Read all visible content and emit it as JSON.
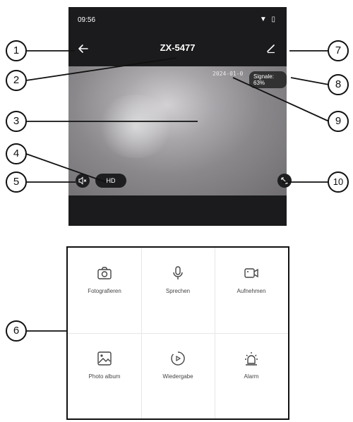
{
  "status": {
    "time": "09:56",
    "right": "▼ ▯"
  },
  "camera": {
    "title": "ZX-5477",
    "timestamp": "2024-01-0",
    "signal": "Signale: 63%",
    "quality": "HD"
  },
  "controls": [
    {
      "label": "Fotografieren",
      "icon": "camera-icon"
    },
    {
      "label": "Sprechen",
      "icon": "microphone-icon"
    },
    {
      "label": "Aufnehmen",
      "icon": "video-record-icon"
    },
    {
      "label": "Photo album",
      "icon": "image-icon"
    },
    {
      "label": "Wiedergabe",
      "icon": "playback-icon"
    },
    {
      "label": "Alarm",
      "icon": "alarm-icon"
    }
  ],
  "callouts": [
    "1",
    "2",
    "3",
    "4",
    "5",
    "6",
    "7",
    "8",
    "9",
    "10"
  ],
  "colors": {
    "dark": "#1b1b1d",
    "callout": "#111111"
  }
}
